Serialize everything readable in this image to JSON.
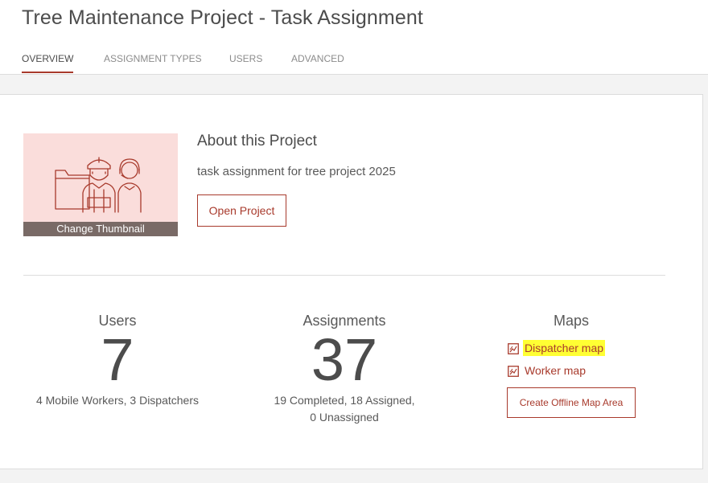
{
  "header": {
    "title": "Tree Maintenance Project - Task Assignment",
    "tabs": [
      {
        "label": "OVERVIEW",
        "active": true
      },
      {
        "label": "ASSIGNMENT TYPES",
        "active": false
      },
      {
        "label": "USERS",
        "active": false
      },
      {
        "label": "ADVANCED",
        "active": false
      }
    ]
  },
  "about": {
    "thumbnail_label": "Change Thumbnail",
    "title": "About this Project",
    "description": "task assignment for tree project 2025",
    "open_button": "Open Project"
  },
  "stats": {
    "users": {
      "label": "Users",
      "value": "7",
      "detail": "4 Mobile Workers, 3 Dispatchers"
    },
    "assignments": {
      "label": "Assignments",
      "value": "37",
      "detail_line1": "19 Completed, 18 Assigned,",
      "detail_line2": "0 Unassigned"
    }
  },
  "maps": {
    "title": "Maps",
    "links": [
      {
        "label": "Dispatcher map",
        "icon": "map-link-icon",
        "highlighted": true
      },
      {
        "label": "Worker map",
        "icon": "map-link-icon",
        "highlighted": false
      }
    ],
    "offline_button": "Create Offline Map Area"
  },
  "colors": {
    "accent": "#a83a2c",
    "thumbnail_bg": "#fadddb",
    "highlight": "#ffff33",
    "page_bg": "#f3f3f3"
  }
}
